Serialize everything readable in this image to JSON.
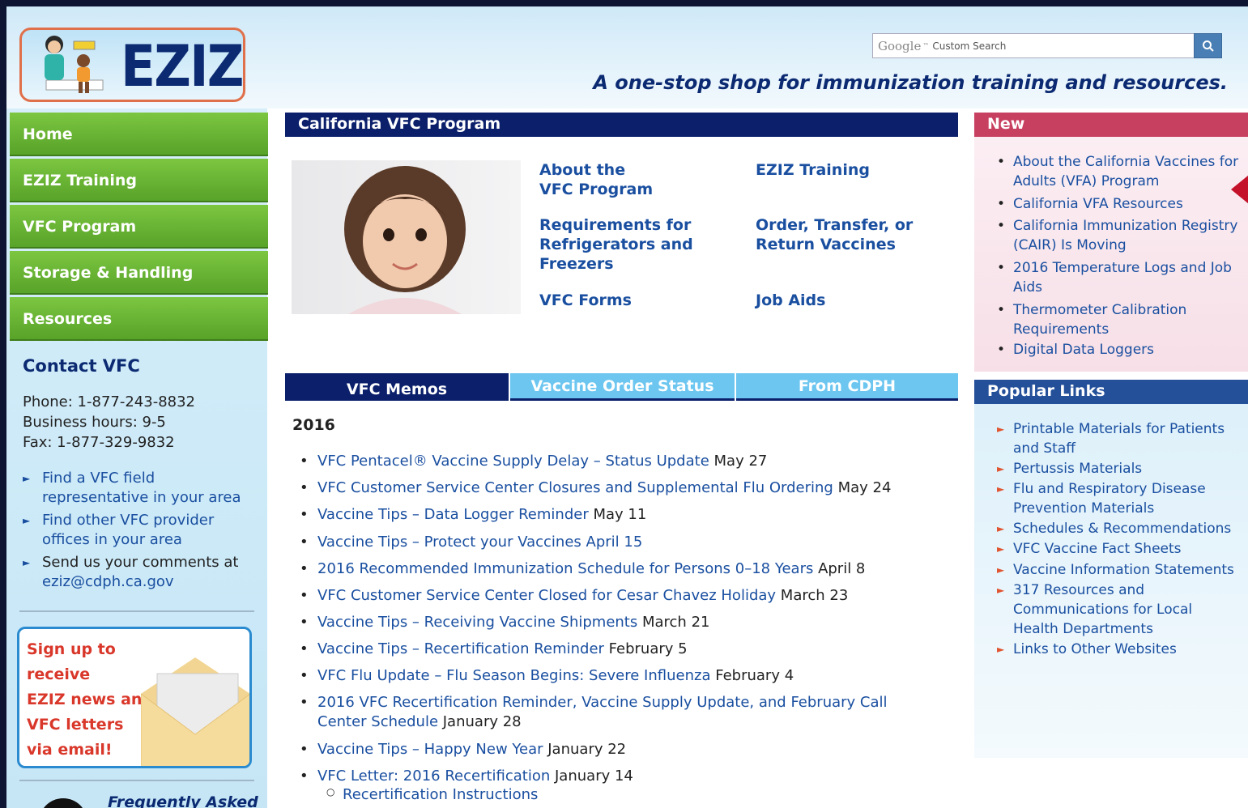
{
  "header": {
    "logo_text": "EZIZ",
    "search": {
      "google_label": "Google",
      "placeholder": "Custom Search"
    },
    "tagline": "A one-stop shop for immunization training and resources."
  },
  "nav": {
    "items": [
      {
        "label": "Home"
      },
      {
        "label": "EZIZ Training"
      },
      {
        "label": "VFC Program"
      },
      {
        "label": "Storage & Handling"
      },
      {
        "label": "Resources"
      }
    ]
  },
  "contact": {
    "title": "Contact VFC",
    "phone": "Phone: 1-877-243-8832",
    "hours": "Business hours: 9-5",
    "fax": "Fax: 1-877-329-9832",
    "links": [
      {
        "line1": "Find a VFC field",
        "line2": "representative in your area"
      },
      {
        "line1": "Find other VFC provider",
        "line2": "offices in your area"
      },
      {
        "line1": "Send us your comments at",
        "line2": "eziz@cdph.ca.gov"
      }
    ]
  },
  "signup": {
    "lines": [
      "Sign up to receive",
      "EZIZ news and",
      "VFC letters",
      "via email!"
    ]
  },
  "faq": {
    "title": "Frequently Asked"
  },
  "main": {
    "title": "California VFC Program",
    "links": [
      {
        "line1": "About the",
        "line2": "VFC Program",
        "line3": ""
      },
      {
        "line1": "EZIZ Training",
        "line2": "",
        "line3": ""
      },
      {
        "line1": "Requirements for",
        "line2": "Refrigerators and",
        "line3": "Freezers"
      },
      {
        "line1": "Order, Transfer, or",
        "line2": "Return Vaccines",
        "line3": ""
      },
      {
        "line1": "VFC Forms",
        "line2": "",
        "line3": ""
      },
      {
        "line1": "Job Aids",
        "line2": "",
        "line3": ""
      }
    ],
    "tabs": [
      {
        "label": "VFC Memos"
      },
      {
        "label": "Vaccine Order Status"
      },
      {
        "label": "From CDPH"
      }
    ],
    "year": "2016",
    "memos": [
      {
        "title": "VFC Pentacel® Vaccine Supply Delay – Status Update",
        "date": " May 27"
      },
      {
        "title": "VFC Customer Service Center Closures and Supplemental Flu Ordering",
        "date": "  May 24"
      },
      {
        "title": "Vaccine Tips – Data Logger Reminder",
        "date": " May 11"
      },
      {
        "title": "Vaccine Tips – Protect your Vaccines",
        "date": " April 15"
      },
      {
        "title": "2016 Recommended Immunization Schedule for Persons 0–18 Years",
        "date": " April 8"
      },
      {
        "title": "VFC Customer Service Center Closed for Cesar Chavez Holiday",
        "date": "  March 23"
      },
      {
        "title": "Vaccine Tips – Receiving Vaccine Shipments",
        "date": " March 21"
      },
      {
        "title": "Vaccine Tips – Recertification Reminder",
        "date": " February 5"
      },
      {
        "title": "VFC Flu Update – Flu Season Begins: Severe Influenza",
        "date": "  February 4"
      },
      {
        "title": "2016 VFC Recertification Reminder, Vaccine Supply Update, and February Call",
        "title2": "Center Schedule",
        "date": " January 28"
      },
      {
        "title": "Vaccine Tips – Happy New Year",
        "date": " January 22"
      },
      {
        "title": "VFC Letter: 2016 Recertification",
        "date": " January 14"
      }
    ],
    "sub_memo": "Recertification Instructions"
  },
  "new_panel": {
    "title": "New",
    "items": [
      {
        "line1": "About the California Vaccines for",
        "line2": "Adults (VFA) Program"
      },
      {
        "line1": "California VFA Resources",
        "line2": ""
      },
      {
        "line1": "California Immunization Registry",
        "line2": "(CAIR) Is Moving"
      },
      {
        "line1": "2016 Temperature Logs and Job",
        "line2": "Aids"
      },
      {
        "line1": "Thermometer Calibration",
        "line2": "Requirements"
      },
      {
        "line1": "Digital Data Loggers",
        "line2": ""
      }
    ]
  },
  "popular": {
    "title": "Popular Links",
    "items": [
      {
        "line1": "Printable Materials for Patients",
        "line2": "and Staff",
        "line3": ""
      },
      {
        "line1": "Pertussis Materials",
        "line2": "",
        "line3": ""
      },
      {
        "line1": "Flu and Respiratory Disease",
        "line2": "Prevention Materials",
        "line3": ""
      },
      {
        "line1": "Schedules & Recommendations",
        "line2": "",
        "line3": ""
      },
      {
        "line1": "VFC Vaccine Fact Sheets",
        "line2": "",
        "line3": ""
      },
      {
        "line1": "Vaccine Information Statements",
        "line2": "",
        "line3": ""
      },
      {
        "line1": "317 Resources and",
        "line2": "Communications for Local",
        "line3": "Health Departments"
      },
      {
        "line1": "Links to Other Websites",
        "line2": "",
        "line3": ""
      }
    ]
  },
  "colors": {
    "navy": "#0b1f6b",
    "nav_green": "#58a329",
    "accent_blue": "#6cc6f0",
    "new_red": "#c84060",
    "link_blue": "#1a4fa0"
  }
}
